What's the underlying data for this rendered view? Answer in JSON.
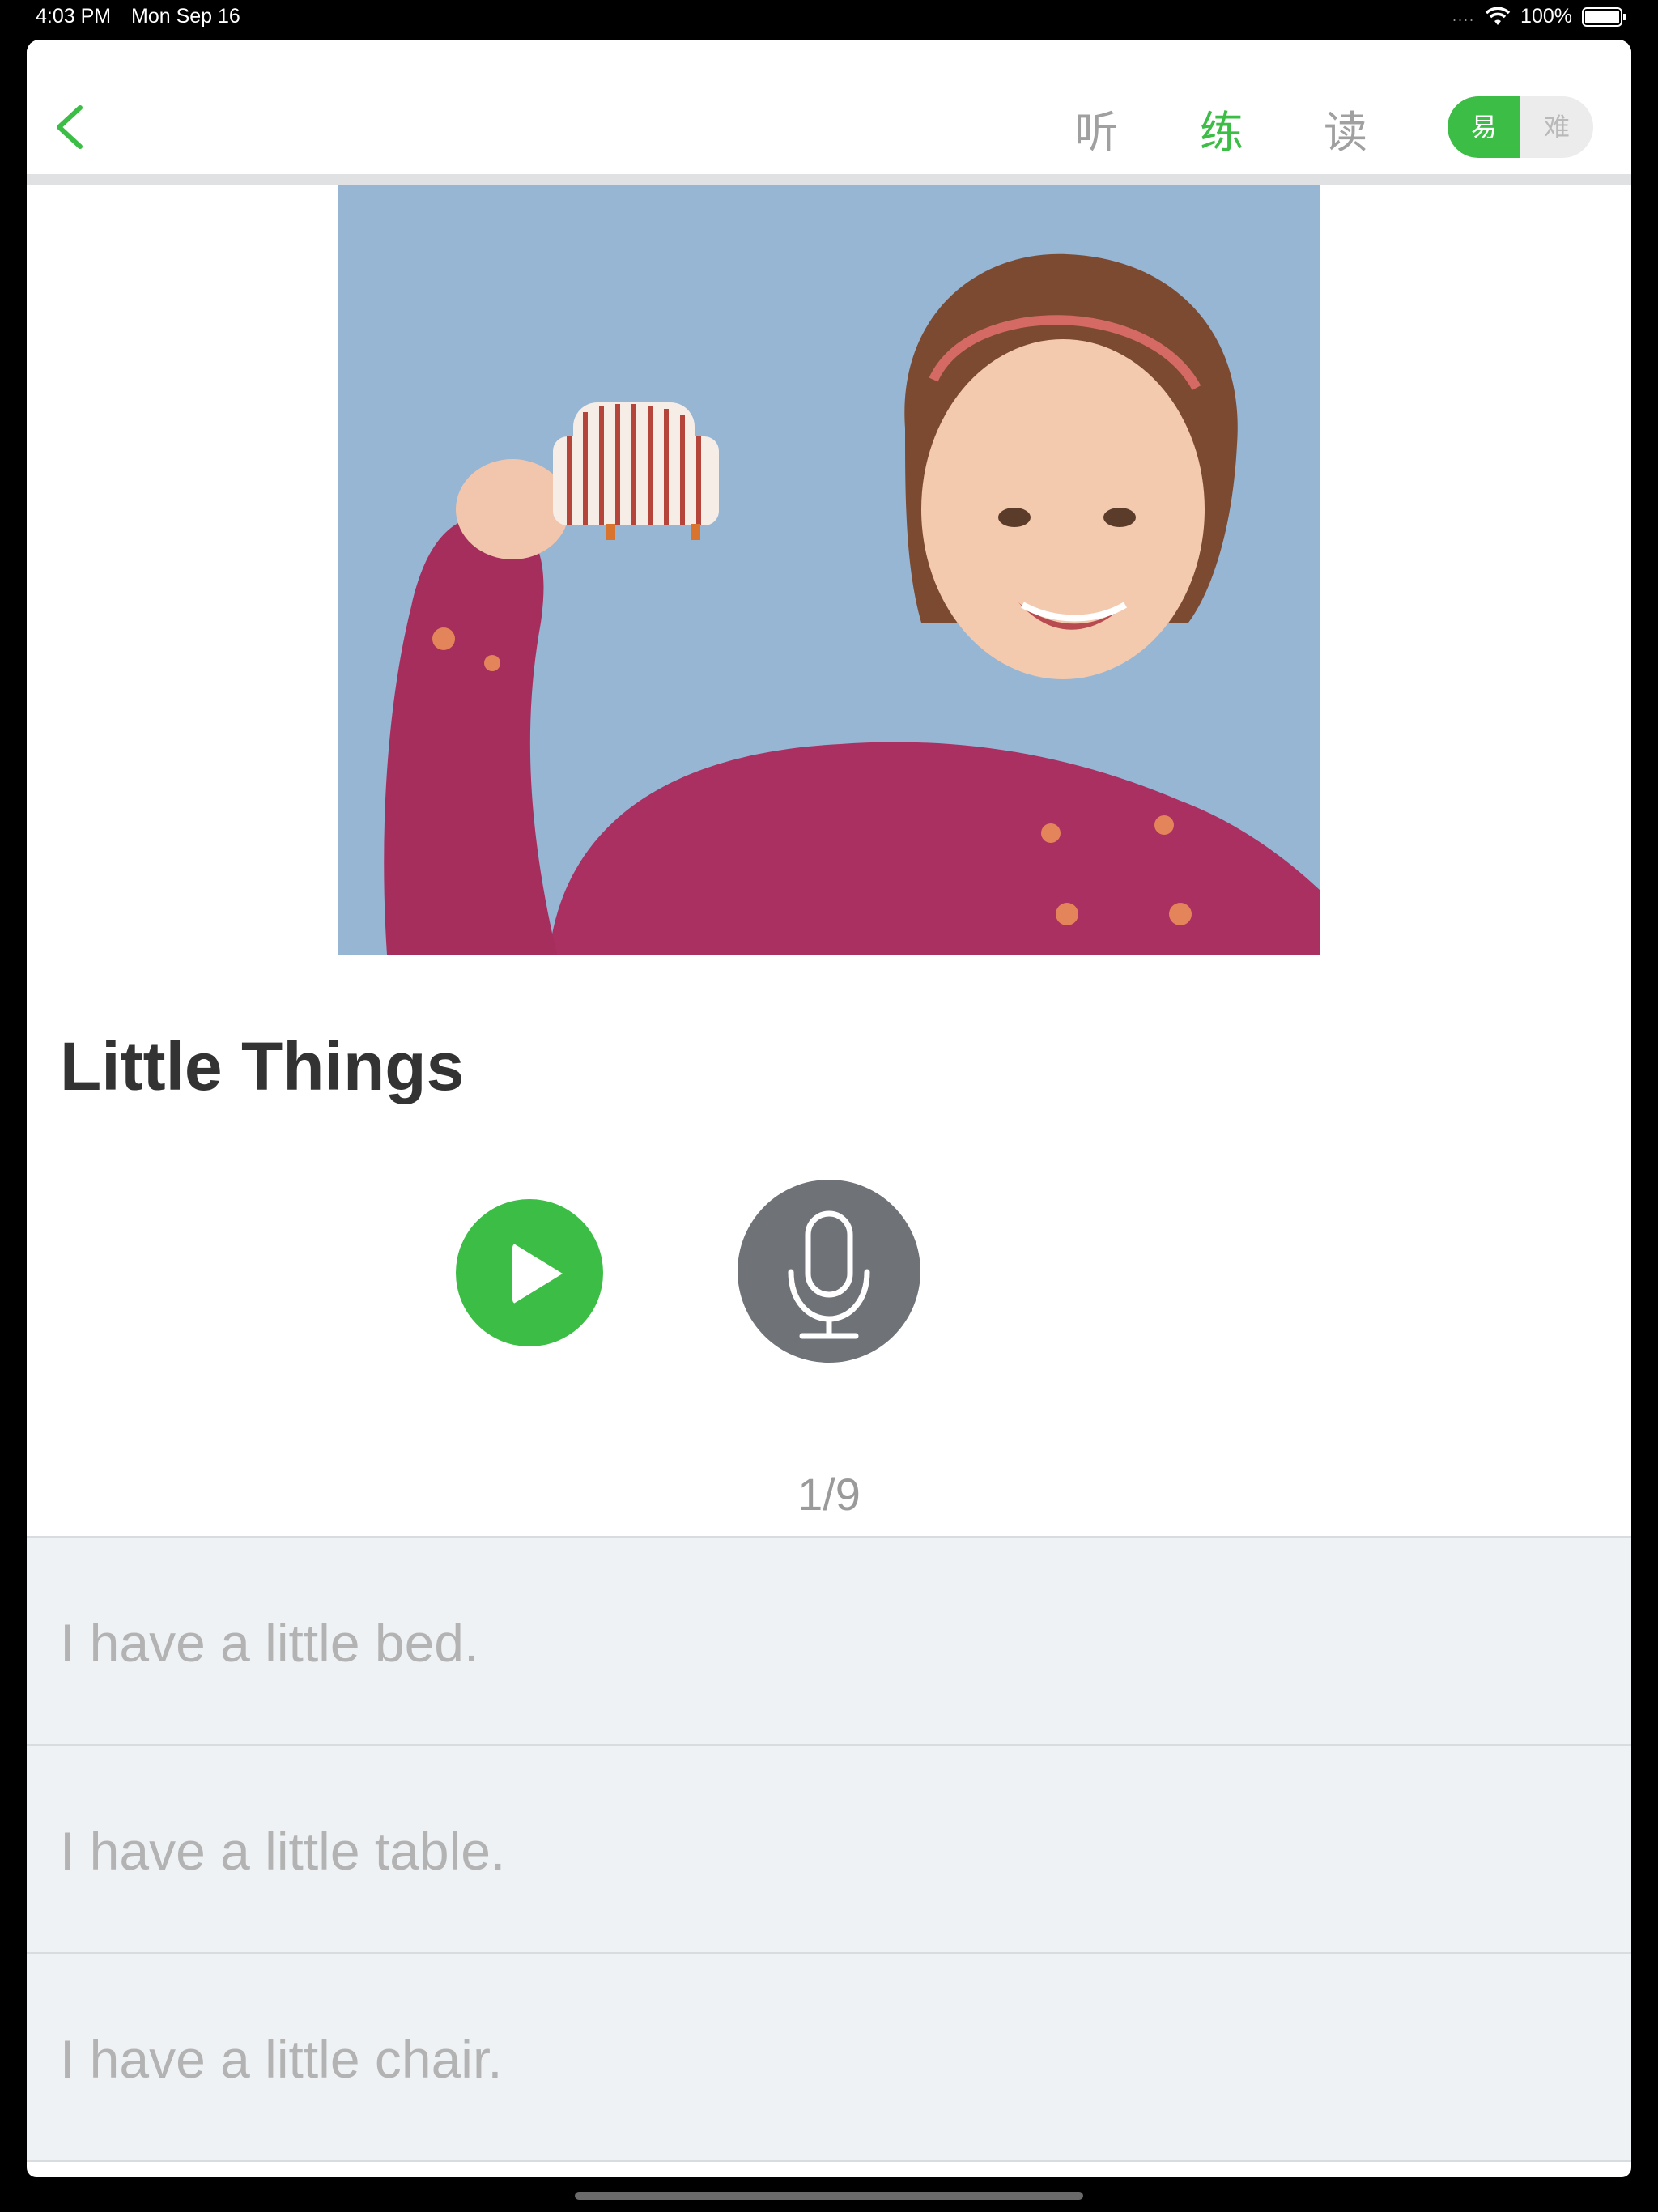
{
  "status_bar": {
    "time": "4:03 PM",
    "date": "Mon Sep 16",
    "battery": "100%",
    "signal_dots": "....",
    "wifi_icon": "wifi-icon",
    "battery_icon": "battery-icon"
  },
  "nav": {
    "back_icon": "chevron-left-icon",
    "tabs": [
      {
        "label": "听",
        "active": false
      },
      {
        "label": "练",
        "active": true
      },
      {
        "label": "读",
        "active": false
      }
    ],
    "level_toggle": {
      "easy": "易",
      "hard": "难",
      "selected": "easy"
    }
  },
  "lesson": {
    "title": "Little Things",
    "counter": "1/9",
    "play_icon": "play-icon",
    "mic_icon": "microphone-icon"
  },
  "sentences": [
    "I have a little bed.",
    "I have a little table.",
    "I have a little chair."
  ],
  "colors": {
    "accent": "#3cbd45",
    "mic_button": "#6f7378",
    "list_bg": "#eef2f5",
    "inactive_tab": "#a0a0a0"
  }
}
